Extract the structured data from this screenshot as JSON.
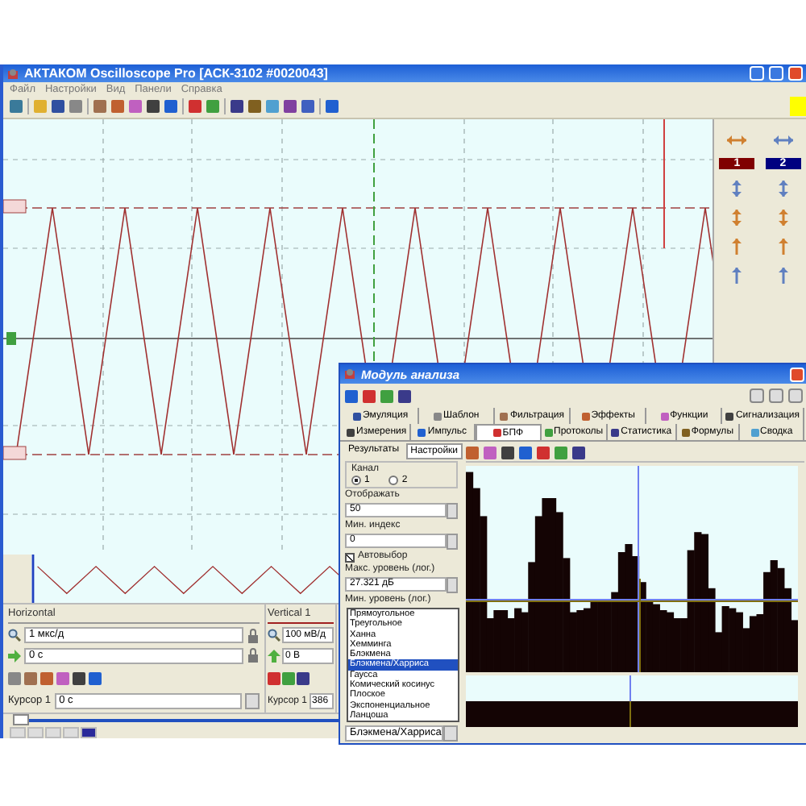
{
  "window": {
    "title": "АКТАКОМ Oscilloscope Pro [АСК-3102 #0020043]"
  },
  "menu": [
    "Файл",
    "Настройки",
    "Вид",
    "Панели",
    "Справка"
  ],
  "right_panel": {
    "channels": [
      {
        "label": "1",
        "color": "#800000"
      },
      {
        "label": "2",
        "color": "#000080"
      }
    ]
  },
  "horizontal": {
    "title": "Horizontal",
    "scale": "1 мкс/д",
    "offset": "0 с",
    "cursor_label": "Курсор 1",
    "cursor_value": "0 с"
  },
  "timeline": {
    "level": 0
  },
  "vertical": {
    "title": "Vertical 1",
    "scale": "100 мВ/д",
    "offset": "0 В",
    "cursor_label": "Курсор 1",
    "cursor_value": "386"
  },
  "analysis": {
    "title": "Модуль анализа",
    "tabs_row1": [
      {
        "label": "Эмуляция",
        "selected": false
      },
      {
        "label": "Шаблон",
        "selected": false
      },
      {
        "label": "Фильтрация",
        "selected": false
      },
      {
        "label": "Эффекты",
        "selected": false
      },
      {
        "label": "Функции",
        "selected": false
      },
      {
        "label": "Сигнализация",
        "selected": false
      }
    ],
    "tabs_row2": [
      {
        "label": "Измерения",
        "selected": false
      },
      {
        "label": "Импульс",
        "selected": false
      },
      {
        "label": "БПФ",
        "selected": true
      },
      {
        "label": "Протоколы",
        "selected": false
      },
      {
        "label": "Статистика",
        "selected": false
      },
      {
        "label": "Формулы",
        "selected": false
      },
      {
        "label": "Сводка",
        "selected": false
      }
    ],
    "subtabs": [
      {
        "label": "Результаты",
        "selected": false
      },
      {
        "label": "Настройки",
        "selected": true
      }
    ],
    "channel_group": {
      "label": "Канал",
      "options": [
        {
          "label": "1",
          "selected": true
        },
        {
          "label": "2",
          "selected": false
        }
      ]
    },
    "display": {
      "label": "Отображать",
      "value": "50"
    },
    "min_index": {
      "label": "Мин. индекс",
      "value": "0"
    },
    "autoselect": {
      "label": "Автовыбор",
      "checked": true
    },
    "max_level": {
      "label": "Макс. уровень (лог.)",
      "value": "27.321 дБ"
    },
    "min_level": {
      "label": "Мин. уровень (лог.)"
    },
    "window_list": [
      {
        "label": "Прямоугольное",
        "selected": false
      },
      {
        "label": "Треугольное",
        "selected": false
      },
      {
        "label": "Ханна",
        "selected": false
      },
      {
        "label": "Хемминга",
        "selected": false
      },
      {
        "label": "Блэкмена",
        "selected": false
      },
      {
        "label": "Блэкмена/Харриса",
        "selected": true
      },
      {
        "label": "Гаусса",
        "selected": false
      },
      {
        "label": "Комический косинус",
        "selected": false
      },
      {
        "label": "Плоское",
        "selected": false
      },
      {
        "label": "Экспоненциальное",
        "selected": false
      },
      {
        "label": "Ланцоша",
        "selected": false
      }
    ],
    "window_select": {
      "value": "Блэкмена/Харриса"
    }
  }
}
